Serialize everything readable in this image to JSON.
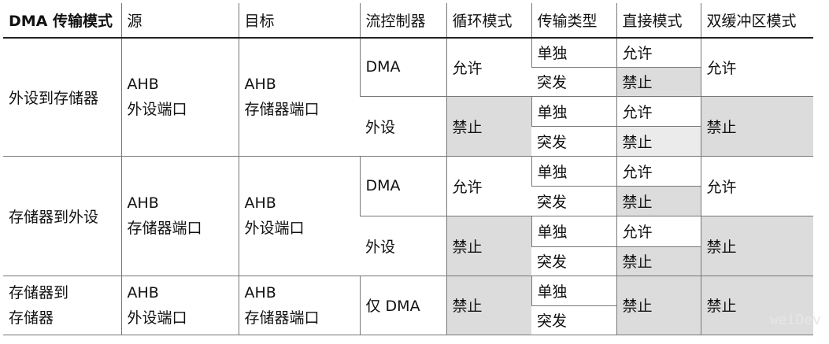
{
  "headers": [
    "DMA 传输模式",
    "源",
    "目标",
    "流控制器",
    "循环模式",
    "传输类型",
    "直接模式",
    "双缓冲区模式"
  ],
  "groups": [
    {
      "mode": "外设到存储器",
      "src": [
        "AHB",
        "外设端口"
      ],
      "dst": [
        "AHB",
        "存储器端口"
      ],
      "rows": [
        {
          "flow": "DMA",
          "circ": "允许",
          "types": [
            "单独",
            "突发"
          ],
          "direct": [
            "允许",
            "禁止"
          ],
          "dbuf": "允许"
        },
        {
          "flow": "外设",
          "circ": "禁止",
          "types": [
            "单独",
            "突发"
          ],
          "direct": [
            "允许",
            "禁止"
          ],
          "dbuf": "禁止"
        }
      ]
    },
    {
      "mode": "存储器到外设",
      "src": [
        "AHB",
        "存储器端口"
      ],
      "dst": [
        "AHB",
        "外设端口"
      ],
      "rows": [
        {
          "flow": "DMA",
          "circ": "允许",
          "types": [
            "单独",
            "突发"
          ],
          "direct": [
            "允许",
            "禁止"
          ],
          "dbuf": "允许"
        },
        {
          "flow": "外设",
          "circ": "禁止",
          "types": [
            "单独",
            "突发"
          ],
          "direct": [
            "允许",
            "禁止"
          ],
          "dbuf": "禁止"
        }
      ]
    },
    {
      "mode": [
        "存储器到",
        "存储器"
      ],
      "src": [
        "AHB",
        "外设端口"
      ],
      "dst": [
        "AHB",
        "存储器端口"
      ],
      "rows": [
        {
          "flow": "仅 DMA",
          "circ": "禁止",
          "types": [
            "单独",
            "突发"
          ],
          "direct": "禁止",
          "dbuf": "禁止"
        }
      ]
    }
  ],
  "watermark": "weiDev"
}
